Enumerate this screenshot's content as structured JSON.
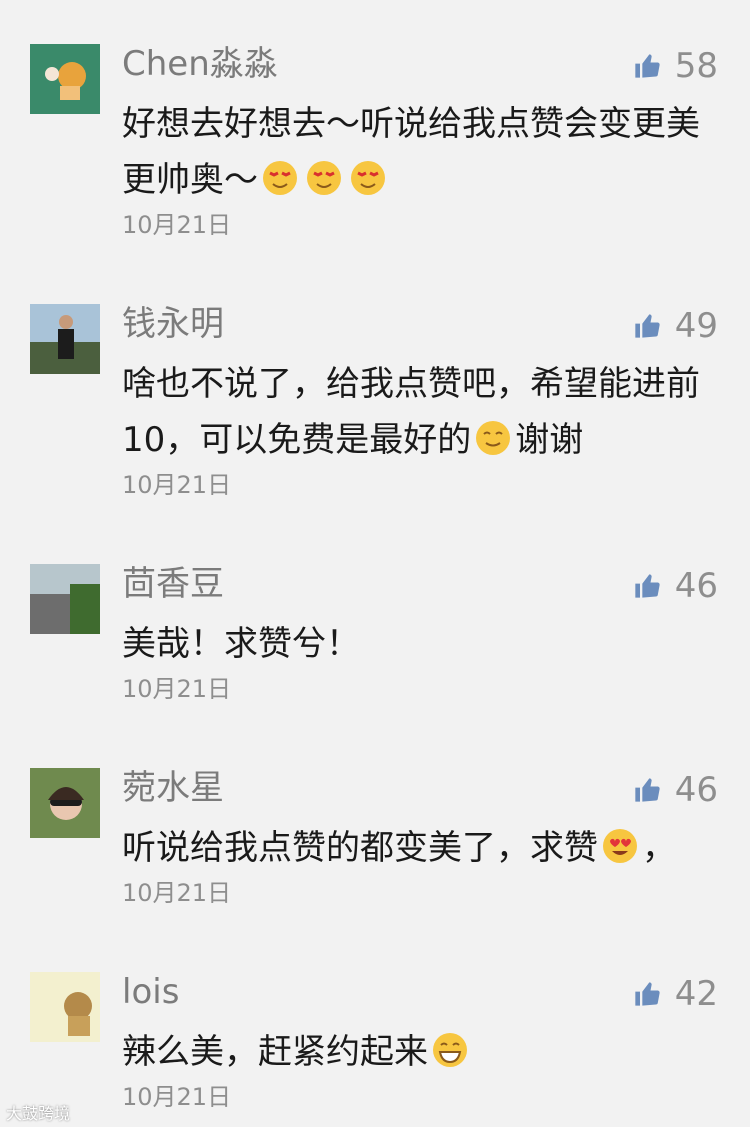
{
  "comments": [
    {
      "name": "Chen淼淼",
      "text": "好想去好想去～听说给我点赞会变更美更帅奥～",
      "emojis": [
        "star-eyes-emoji",
        "star-eyes-emoji",
        "star-eyes-emoji"
      ],
      "likes": "58",
      "date": "10月21日"
    },
    {
      "name": "钱永明",
      "text": "啥也不说了，给我点赞吧，希望能进前10，可以免费是最好的",
      "emoji_after": "smile-emoji",
      "text_tail": "谢谢",
      "likes": "49",
      "date": "10月21日"
    },
    {
      "name": "茴香豆",
      "text": "美哉！求赞兮！",
      "likes": "46",
      "date": "10月21日"
    },
    {
      "name": "菀水星",
      "text": "听说给我点赞的都变美了，求赞",
      "emoji_after": "heart-eyes-emoji",
      "text_tail": "，",
      "likes": "46",
      "date": "10月21日"
    },
    {
      "name": "lois",
      "text": "辣么美，赶紧约起来",
      "emoji_after": "grin-emoji",
      "likes": "42",
      "date": "10月21日"
    }
  ],
  "watermark": "大鼓跨境",
  "colors": {
    "thumb": "#6b8dbd",
    "background": "#f2f2f2"
  }
}
